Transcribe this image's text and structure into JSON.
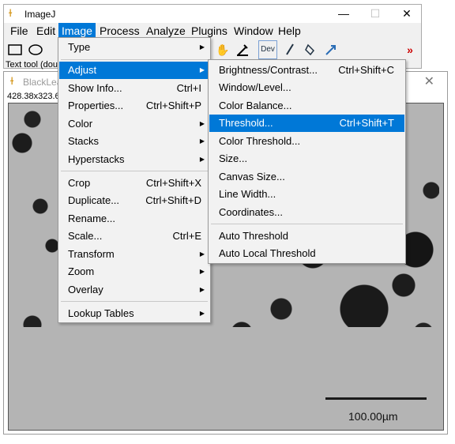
{
  "image_window": {
    "title": "BlackLea",
    "info": "428.38x323.6",
    "close_glyph": "✕",
    "scale_label": "100.00µm"
  },
  "main_window": {
    "title": "ImageJ",
    "app_icon": "microscope-icon",
    "buttons": {
      "minimize": "—",
      "maximize": "☐",
      "close": "✕"
    },
    "menubar": [
      "File",
      "Edit",
      "Image",
      "Process",
      "Analyze",
      "Plugins",
      "Window",
      "Help"
    ],
    "active_menu": "Image",
    "status_text": "Text tool (dou",
    "toolbar": {
      "rect": "rectangle-tool-icon",
      "oval": "oval-tool-icon",
      "hand": "hand-tool-icon",
      "dropper": "color-picker-icon",
      "dev": "Dev",
      "brush": "brush-icon",
      "flood": "flood-fill-icon",
      "arrow": "arrow-tool-icon",
      "more": "»"
    }
  },
  "image_menu": {
    "type": {
      "label": "Type"
    },
    "adjust": {
      "label": "Adjust"
    },
    "show_info": {
      "label": "Show Info...",
      "shortcut": "Ctrl+I"
    },
    "properties": {
      "label": "Properties...",
      "shortcut": "Ctrl+Shift+P"
    },
    "color": {
      "label": "Color"
    },
    "stacks": {
      "label": "Stacks"
    },
    "hyperstacks": {
      "label": "Hyperstacks"
    },
    "crop": {
      "label": "Crop",
      "shortcut": "Ctrl+Shift+X"
    },
    "duplicate": {
      "label": "Duplicate...",
      "shortcut": "Ctrl+Shift+D"
    },
    "rename": {
      "label": "Rename..."
    },
    "scale": {
      "label": "Scale...",
      "shortcut": "Ctrl+E"
    },
    "transform": {
      "label": "Transform"
    },
    "zoom": {
      "label": "Zoom"
    },
    "overlay": {
      "label": "Overlay"
    },
    "lookup_tables": {
      "label": "Lookup Tables"
    }
  },
  "adjust_menu": {
    "brightness": {
      "label": "Brightness/Contrast...",
      "shortcut": "Ctrl+Shift+C"
    },
    "window_level": {
      "label": "Window/Level..."
    },
    "color_balance": {
      "label": "Color Balance..."
    },
    "threshold": {
      "label": "Threshold...",
      "shortcut": "Ctrl+Shift+T"
    },
    "color_threshold": {
      "label": "Color Threshold..."
    },
    "size": {
      "label": "Size..."
    },
    "canvas_size": {
      "label": "Canvas Size..."
    },
    "line_width": {
      "label": "Line Width..."
    },
    "coordinates": {
      "label": "Coordinates..."
    },
    "auto_threshold": {
      "label": "Auto Threshold"
    },
    "auto_local_threshold": {
      "label": "Auto Local Threshold"
    }
  },
  "colors": {
    "highlight": "#0078d7",
    "menu_bg": "#f2f2f2",
    "image_bg": "#b4b4b4"
  }
}
